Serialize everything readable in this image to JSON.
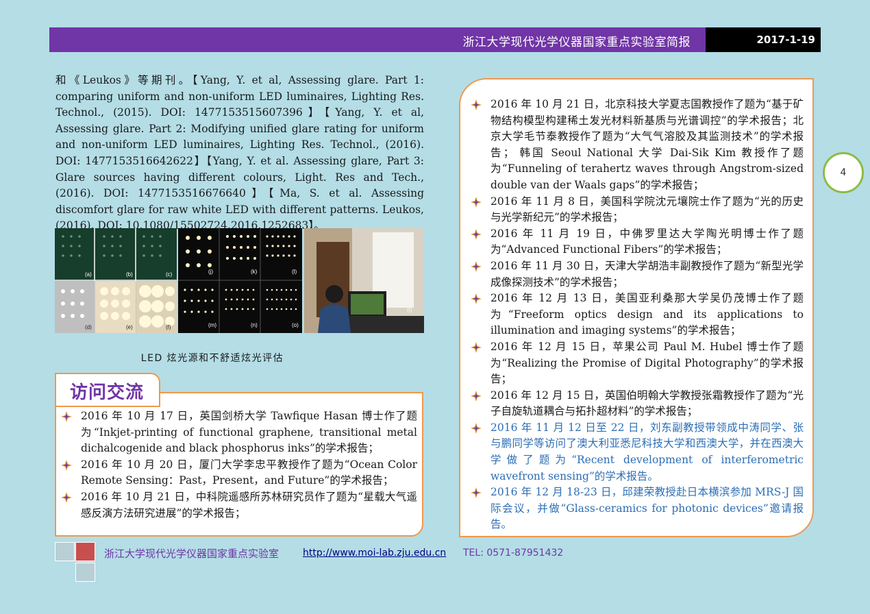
{
  "header": {
    "title": "浙江大学现代光学仪器国家重点实验室简报",
    "date": "2017-1-19"
  },
  "citation_block": {
    "text": "和《Leukos》等期刊。【Yang, Y. et al, Assessing glare. Part 1: comparing uniform and non-uniform LED luminaires, Lighting Res. Technol., (2015). DOI: 1477153515607396】【Yang, Y. et al, Assessing glare. Part 2: Modifying unified glare rating for uniform and non-uniform LED luminaires, Lighting Res. Technol., (2016). DOI: 1477153516642622】【Yang, Y. et al. Assessing glare, Part 3: Glare sources having different colours, Light. Res and Tech., (2016). DOI: 1477153516676640】【Ma, S. et al. Assessing discomfort glare for raw white LED with different patterns. Leukos, (2016). DOI: 10.1080/15502724.2016.1252683】。"
  },
  "figure": {
    "caption": "LED 炫光源和不舒适炫光评估",
    "panel_labels": [
      "(a)",
      "(b)",
      "(c)",
      "(d)",
      "(e)",
      "(f)",
      "(j)",
      "(k)",
      "(l)",
      "(m)",
      "(n)",
      "(o)",
      "(i)"
    ]
  },
  "section": {
    "title": "访问交流"
  },
  "left_items": [
    "2016 年 10 月 17 日，英国剑桥大学 Tawfique Hasan 博士作了题为“Inkjet-printing of functional graphene, transitional metal dichalcogenide and black phosphorus inks”的学术报告；",
    "2016 年 10 月 20 日，厦门大学李忠平教授作了题为“Ocean Color Remote Sensing：Past，Present，and Future”的学术报告；",
    "2016 年 10 月 21 日，中科院遥感所苏林研究员作了题为“星载大气遥感反演方法研究进展”的学术报告；"
  ],
  "right_items": [
    "2016 年 10 月 21 日，北京科技大学夏志国教授作了题为“基于矿物结构模型构建稀土发光材料新基质与光谱调控”的学术报告；北京大学毛节泰教授作了题为“大气气溶胶及其监测技术”的学术报告； 韩国 Seoul National 大学 Dai-Sik Kim 教授作了题为“Funneling of terahertz waves through Angstrom-sized double van der Waals gaps”的学术报告；",
    "2016 年 11 月 8 日，美国科学院沈元壤院士作了题为“光的历史与光学新纪元”的学术报告；",
    "2016 年 11 月 19 日，中佛罗里达大学陶光明博士作了题为“Advanced Functional Fibers”的学术报告；",
    "2016 年 11 月 30 日，天津大学胡浩丰副教授作了题为“新型光学成像探测技术”的学术报告；",
    "2016 年 12 月 13 日，美国亚利桑那大学吴仍茂博士作了题为“Freeform optics design and its applications to illumination and imaging systems”的学术报告；",
    "2016 年 12 月 15 日，苹果公司 Paul M. Hubel 博士作了题为“Realizing the Promise of Digital Photography”的学术报告；",
    "2016 年 12 月 15 日，英国伯明翰大学教授张霜教授作了题为“光子自旋轨道耦合与拓扑超材料”的学术报告；",
    "2016 年 11 月 12 日至 22 日，刘东副教授带领成中涛同学、张与鹏同学等访问了澳大利亚悉尼科技大学和西澳大学，并在西澳大学做了题为“Recent development of interferometric wavefront sensing”的学术报告。",
    "2016 年 12 月 18-23 日，邱建荣教授赴日本横滨参加 MRS-J 国际会议，并做“Glass-ceramics for photonic devices”邀请报告。"
  ],
  "page_number": "4",
  "footer": {
    "org": "浙江大学现代光学仪器国家重点实验室",
    "url": "http://www.moi-lab.zju.edu.cn",
    "tel": "TEL: 0571-87951432"
  },
  "colors": {
    "background": "#b4dde6",
    "header_purple": "#7035a6",
    "box_border": "#f0984b",
    "blue_text": "#2d6eb5",
    "page_circle": "#8dbb45"
  }
}
